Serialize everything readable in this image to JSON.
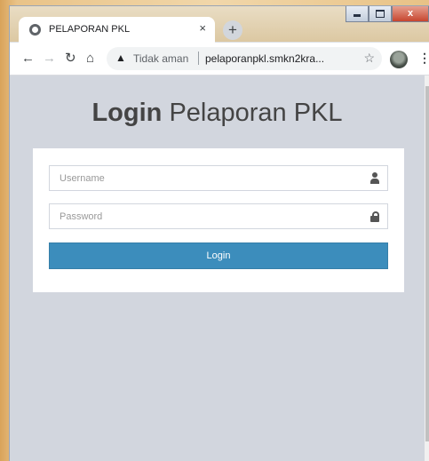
{
  "browser": {
    "tab_title": "PELAPORAN PKL",
    "tab_close": "×",
    "new_tab": "+",
    "security_label": "Tidak aman",
    "url": "pelaporanpkl.smkn2kra...",
    "window_controls": {
      "minimize": "",
      "maximize": "",
      "close": "x"
    }
  },
  "page": {
    "logo_bold": "Login",
    "logo_light": "Pelaporan PKL",
    "username_placeholder": "Username",
    "password_placeholder": "Password",
    "login_button": "Login"
  },
  "colors": {
    "page_bg": "#d2d6de",
    "button": "#3c8dbc"
  }
}
